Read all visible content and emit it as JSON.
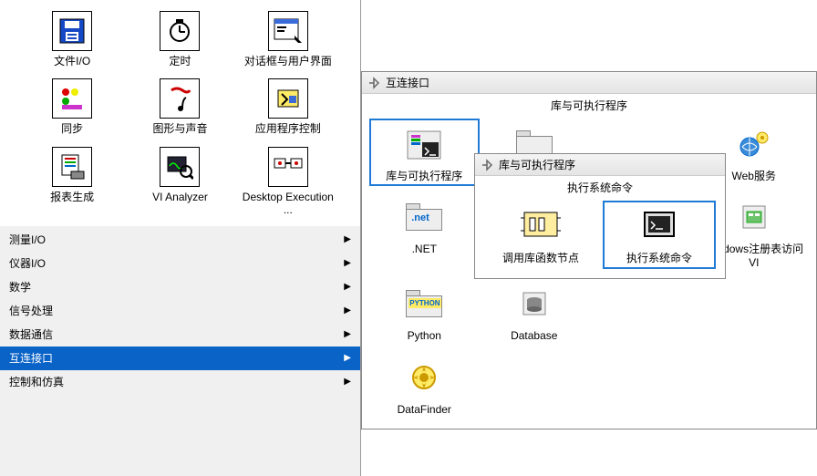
{
  "panel1": {
    "grid": [
      {
        "label": "文件I/O",
        "icon": "floppy-icon"
      },
      {
        "label": "定时",
        "icon": "watch-icon"
      },
      {
        "label": "对话框与用户界面",
        "icon": "dialog-icon"
      },
      {
        "label": "同步",
        "icon": "sync-icon"
      },
      {
        "label": "图形与声音",
        "icon": "graphics-sound-icon"
      },
      {
        "label": "应用程序控制",
        "icon": "app-control-icon"
      },
      {
        "label": "报表生成",
        "icon": "report-icon"
      },
      {
        "label": "VI Analyzer",
        "icon": "vi-analyzer-icon"
      },
      {
        "label": "Desktop Execution ...",
        "icon": "desktop-exec-icon"
      }
    ],
    "menu": [
      {
        "label": "测量I/O",
        "highlight": false
      },
      {
        "label": "仪器I/O",
        "highlight": false
      },
      {
        "label": "数学",
        "highlight": false
      },
      {
        "label": "信号处理",
        "highlight": false
      },
      {
        "label": "数据通信",
        "highlight": false
      },
      {
        "label": "互连接口",
        "highlight": true
      },
      {
        "label": "控制和仿真",
        "highlight": false
      }
    ]
  },
  "panel2": {
    "title": "互连接口",
    "section": "库与可执行程序",
    "items": [
      {
        "label": "库与可执行程序",
        "icon": "lib-icon",
        "selected": true
      },
      {
        "label": "",
        "icon": "activex-icon"
      },
      {
        "label": "",
        "icon": ""
      },
      {
        "label": "Web服务",
        "icon": "web-icon"
      },
      {
        "label": ".NET",
        "icon": "dotnet-icon"
      },
      {
        "label": "",
        "icon": ""
      },
      {
        "label": "",
        "icon": ""
      },
      {
        "label": "Windows注册表访问VI",
        "icon": "registry-icon"
      },
      {
        "label": "Python",
        "icon": "python-icon"
      },
      {
        "label": "Database",
        "icon": "database-icon"
      },
      {
        "label": "",
        "icon": ""
      },
      {
        "label": "",
        "icon": ""
      },
      {
        "label": "DataFinder",
        "icon": "datafinder-icon"
      }
    ]
  },
  "panel3": {
    "title": "库与可执行程序",
    "section": "执行系统命令",
    "items": [
      {
        "label": "调用库函数节点",
        "icon": "call-lib-icon",
        "selected": false
      },
      {
        "label": "执行系统命令",
        "icon": "system-cmd-icon",
        "selected": true
      }
    ]
  }
}
